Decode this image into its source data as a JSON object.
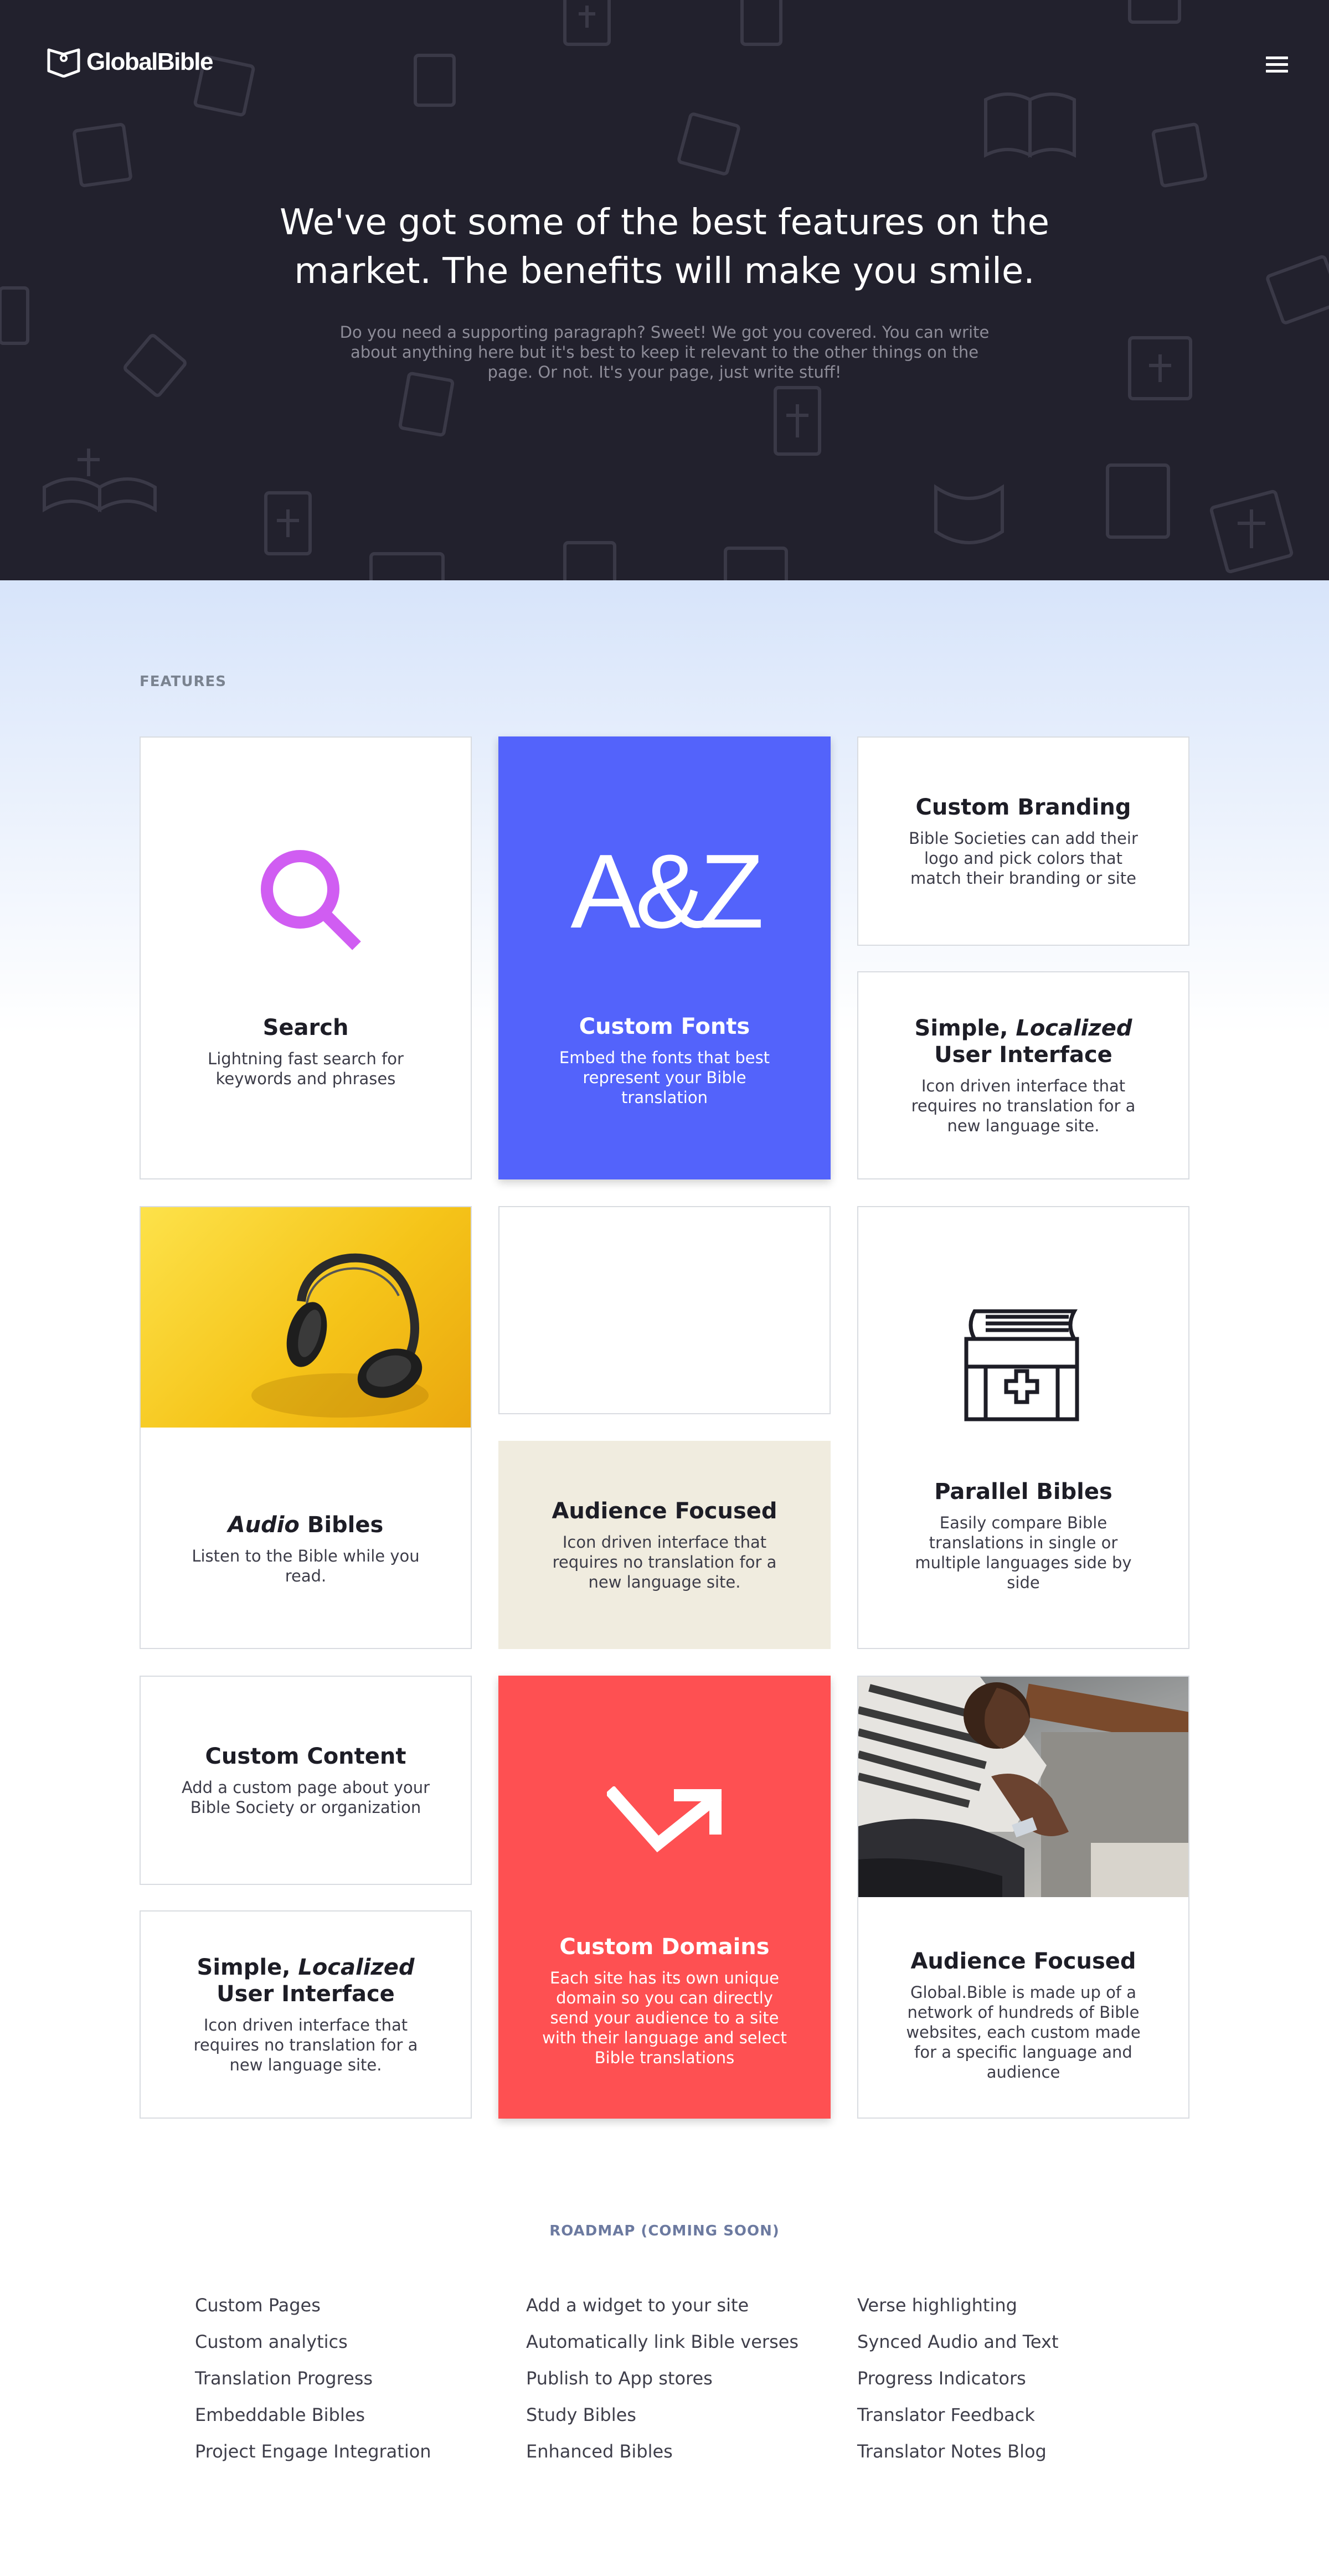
{
  "brand": {
    "name": "GlobalBible"
  },
  "hero": {
    "title": "We've got some of the best features on the market. The benefits will make you smile.",
    "subtitle": "Do you need a supporting paragraph? Sweet! We got you covered. You can write about anything here but it's best to keep it relevant to the other things on the page. Or not. It's your page, just write stuff!"
  },
  "features": {
    "label": "FEATURES",
    "cards": {
      "search": {
        "title": "Search",
        "desc": "Lightning fast search for keywords and phrases"
      },
      "fonts": {
        "title": "Custom Fonts",
        "desc": "Embed the fonts that best represent your Bible translation",
        "glyph": "A&Z"
      },
      "branding": {
        "title": "Custom Branding",
        "desc": "Bible Societies can add their logo and pick colors that match their branding or site"
      },
      "localized_ui": {
        "title_prefix": "Simple, ",
        "title_em": "Localized",
        "title_rest": "User Interface",
        "desc": "Icon driven interface that requires no translation for a new language site."
      },
      "audio": {
        "title_em": "Audio",
        "title_rest": " Bibles",
        "desc": "Listen to the Bible while you read."
      },
      "audience_beige": {
        "title": "Audience Focused",
        "desc": "Icon driven interface that requires no translation for a new language site."
      },
      "parallel": {
        "title": "Parallel Bibles",
        "desc": "Easily compare Bible translations in single or multiple languages side by side"
      },
      "custom_content": {
        "title": "Custom Content",
        "desc": "Add a custom page about your Bible Society or organization"
      },
      "localized_ui_2": {
        "title_prefix": "Simple, ",
        "title_em": "Localized",
        "title_rest": "User Interface",
        "desc": "Icon driven interface that requires no translation for a new language site."
      },
      "domains": {
        "title": "Custom Domains",
        "desc": "Each site has its own unique domain so you can directly send your audience to a site with their language and select Bible translations"
      },
      "audience_photo": {
        "title": "Audience Focused",
        "desc": "Global.Bible is made up of a network of hundreds of Bible websites, each custom made for a specific language and audience"
      }
    },
    "colors": {
      "purple": "#d05df2",
      "blue": "#5363fb",
      "red": "#fe5052",
      "beige": "#f0ecdf",
      "yellow": "#f2c21b"
    }
  },
  "roadmap": {
    "label": "ROADMAP (COMING SOON)",
    "columns": [
      [
        "Custom Pages",
        "Custom analytics",
        "Translation Progress",
        "Embeddable Bibles",
        "Project Engage Integration"
      ],
      [
        "Add a widget to your site",
        "Automatically link Bible verses",
        "Publish to App stores",
        "Study Bibles",
        "Enhanced Bibles"
      ],
      [
        "Verse highlighting",
        "Synced Audio and Text",
        "Progress Indicators",
        "Translator Feedback",
        "Translator Notes Blog"
      ]
    ]
  }
}
